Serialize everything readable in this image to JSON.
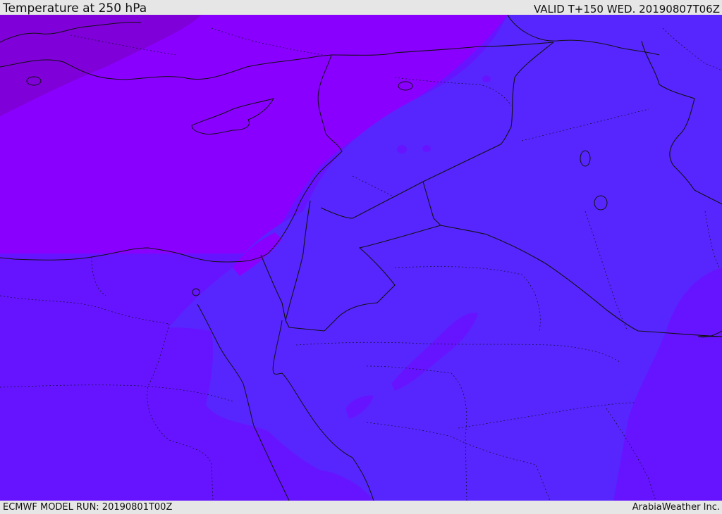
{
  "header": {
    "title": "Temperature at 250 hPa",
    "valid": "VALID T+150 WED. 20190807T06Z"
  },
  "footer": {
    "model_run": "ECMWF MODEL RUN: 20190801T00Z",
    "credit": "ArabiaWeather Inc."
  },
  "map": {
    "field": "temperature",
    "level": "250 hPa",
    "colors": {
      "coldest": "#7f00d8",
      "cold": "#8a00ff",
      "mid": "#6614ff",
      "warm": "#5726ff",
      "border": "#111111"
    }
  }
}
